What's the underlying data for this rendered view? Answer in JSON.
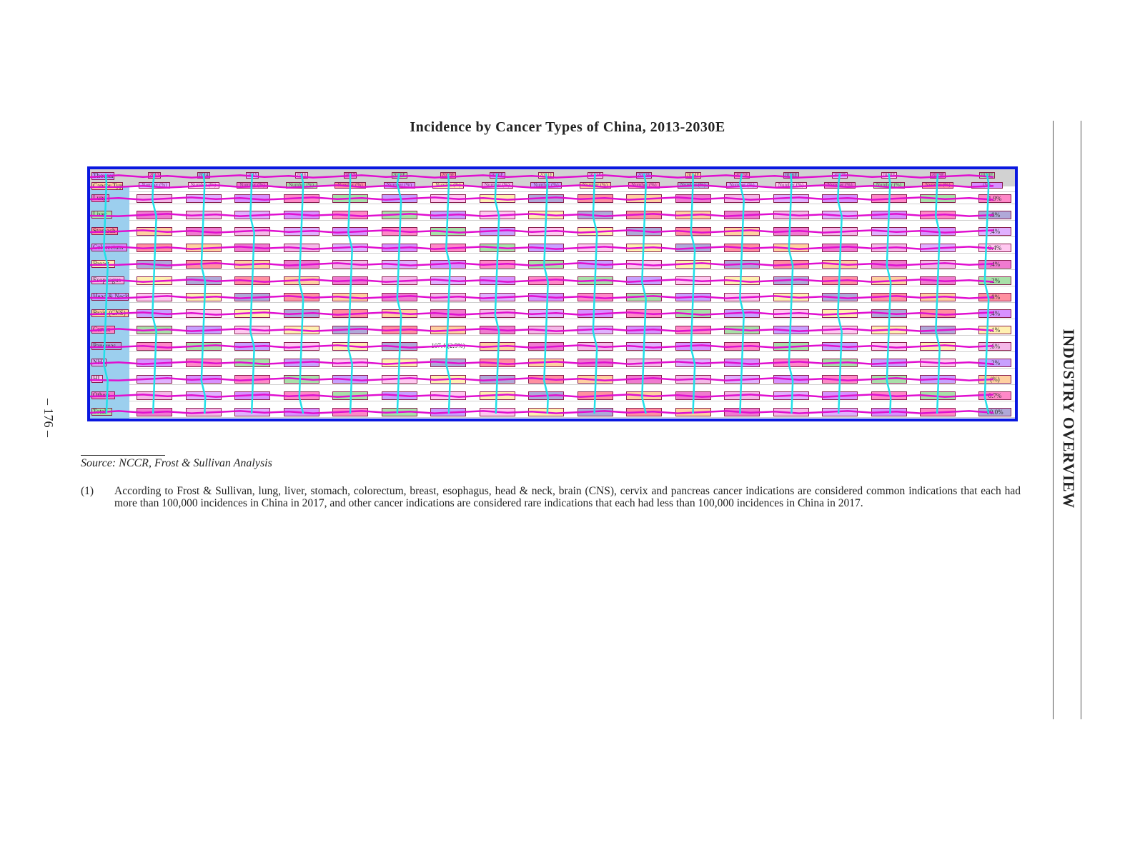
{
  "page": {
    "title": "Incidence by Cancer Types of China, 2013-2030E",
    "side_heading": "INDUSTRY OVERVIEW",
    "page_number": "– 176 –"
  },
  "source": {
    "text": "Source: NCCR, Frost & Sullivan Analysis"
  },
  "footnote": {
    "marker": "(1)",
    "text": "According to Frost & Sullivan, lung, liver, stomach, colorectum, breast, esophagus, head & neck, brain (CNS), cervix and pancreas cancer indications are considered common indications that each had more than 100,000 incidences in China in 2017, and other cancer indications are considered rare indications that each had less than 100,000 incidences in China in 2017."
  },
  "table": {
    "header": {
      "first": "Thousand",
      "years": [
        "2013",
        "2014",
        "2015",
        "2016",
        "2017",
        "2018E",
        "2019E",
        "2020E",
        "2021E",
        "2022E",
        "2023E",
        "2024E",
        "2025E",
        "2026E",
        "2027E",
        "2028E",
        "2029E",
        "2030E"
      ]
    },
    "subheader": {
      "first": "Cancer Type",
      "cells": [
        "Number (%)",
        "Number (%)",
        "Number (%)",
        "Number (%)",
        "Number (%)",
        "Number (%)",
        "Number (%)",
        "Number (%)",
        "Number (%)",
        "Number (%)",
        "Number (%)",
        "Number (%)",
        "Number (%)",
        "Number (%)",
        "Number (%)",
        "Number (%)",
        "Number (%)",
        "Number (%)"
      ],
      "last_visible": "(%)"
    },
    "rows": [
      {
        "label": "Lung",
        "cells": [
          "",
          "",
          "",
          "",
          "",
          "",
          "",
          "",
          "",
          "",
          "",
          "",
          "",
          "",
          "",
          "",
          "",
          "1.9%"
        ]
      },
      {
        "label": "Liver",
        "cells": [
          "",
          "",
          "",
          "",
          "",
          "",
          "",
          "",
          "",
          "",
          "",
          "",
          "",
          "",
          "",
          "",
          "",
          ".8%"
        ]
      },
      {
        "label": "Stomach",
        "cells": [
          "",
          "",
          "",
          "",
          "",
          "",
          "",
          "",
          "",
          "",
          "",
          "",
          "",
          "",
          "",
          "",
          "",
          ".4%"
        ]
      },
      {
        "label": "Colorectum",
        "cells": [
          "",
          "",
          "",
          "",
          "",
          "",
          "",
          "",
          "",
          "",
          "",
          "",
          "",
          "",
          "",
          "",
          "",
          "0.4%"
        ]
      },
      {
        "label": "Breast",
        "cells": [
          "",
          "",
          "",
          "",
          "",
          "",
          "",
          "",
          "",
          "",
          "",
          "",
          "",
          "",
          "",
          "",
          "",
          ".4%"
        ]
      },
      {
        "label": "Esophagus",
        "cells": [
          "",
          "",
          "",
          "",
          "",
          "",
          "",
          "",
          "",
          "",
          "",
          "",
          "",
          "",
          "",
          "",
          "",
          ".2%"
        ]
      },
      {
        "label": "Head & Neck",
        "cells": [
          "",
          "",
          "",
          "",
          "",
          "",
          "",
          "",
          "",
          "",
          "",
          "",
          "",
          "",
          "",
          "",
          "",
          ".8%"
        ]
      },
      {
        "label": "Brain (CNS)",
        "cells": [
          "",
          "",
          "",
          "",
          "",
          "",
          "",
          "",
          "",
          "",
          "",
          "",
          "",
          "",
          "",
          "",
          "",
          ".4%"
        ]
      },
      {
        "label": "Cervix",
        "cells": [
          "",
          "",
          "",
          "",
          "",
          "",
          "",
          "",
          "",
          "",
          "",
          "",
          "",
          "",
          "",
          "",
          "",
          ".1%"
        ]
      },
      {
        "label": "Pancreas",
        "cells": [
          "",
          "",
          "",
          "",
          "",
          "",
          "107.4 (2.5%)",
          "",
          "",
          "",
          "",
          "",
          "",
          "",
          "",
          "",
          "",
          ".6%"
        ]
      },
      {
        "label": "NHL",
        "cells": [
          "",
          "",
          "",
          "",
          "",
          "",
          "",
          "",
          "",
          "",
          "",
          "",
          "",
          "",
          "",
          "",
          "",
          ".2%"
        ]
      },
      {
        "label": "HL",
        "cells": [
          "",
          "",
          "",
          "",
          "",
          "",
          "",
          "",
          "",
          "",
          "",
          "",
          "",
          "",
          "",
          "",
          "",
          "(%)"
        ]
      },
      {
        "label": "Others",
        "cells": [
          "",
          "",
          "",
          "",
          "",
          "",
          "",
          "",
          "",
          "",
          "",
          "",
          "",
          "",
          "",
          "",
          "",
          "0.7%"
        ]
      },
      {
        "label": "Total",
        "cells": [
          "",
          "",
          "",
          "",
          "",
          "",
          "",
          "",
          "",
          "",
          "",
          "",
          "",
          "",
          "",
          "",
          "",
          "00.0%"
        ]
      }
    ]
  },
  "colors": {
    "frame": "#0a18e0",
    "first_column": "#9ccfee",
    "header_band": "#d2d2d2",
    "row_trace": "#e010d0",
    "column_trace": "#20e0e8"
  },
  "cell_fills": [
    "#f5b8e8",
    "#c8a0ff",
    "#ffd0a0",
    "#ff88c8",
    "#b0a8d8",
    "#e0b0ff",
    "#ffc8f0",
    "#f07ad0",
    "#a8e0a8",
    "#ff90a0",
    "#d890ff",
    "#fff0b0"
  ]
}
